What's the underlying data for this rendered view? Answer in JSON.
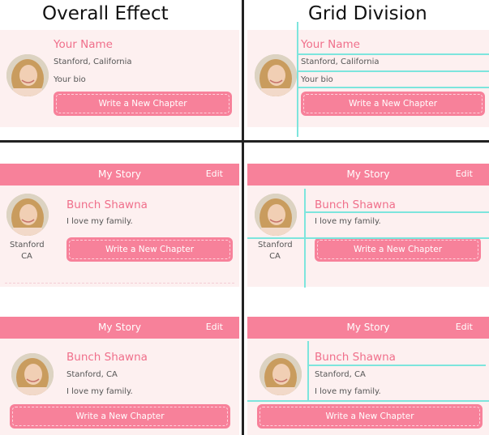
{
  "headers": {
    "left": "Overall Effect",
    "right": "Grid Division"
  },
  "profile_top": {
    "name": "Your Name",
    "location": "Stanford, California",
    "bio": "Your bio",
    "button": "Write a New Chapter"
  },
  "profile_mid": {
    "bar_title": "My Story",
    "edit": "Edit",
    "name": "Bunch Shawna",
    "bio": "I love my family.",
    "loc_line1": "Stanford",
    "loc_line2": "CA",
    "button": "Write a New Chapter"
  },
  "profile_bottom": {
    "bar_title": "My Story",
    "edit": "Edit",
    "name": "Bunch Shawna",
    "location": "Stanford, CA",
    "bio": "I love my family.",
    "button": "Write a New Chapter"
  },
  "colors": {
    "accent": "#f7819a",
    "name": "#f06f8b",
    "card": "#fdf0f0",
    "grid_line": "#7de5dd"
  },
  "icons": {
    "avatar": "profile-photo"
  }
}
